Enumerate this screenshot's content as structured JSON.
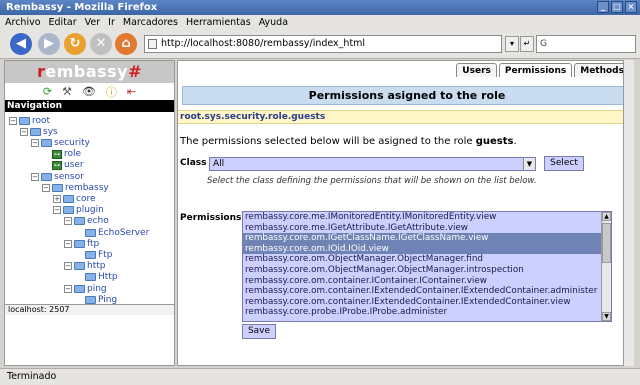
{
  "window": {
    "title": "Rembassy - Mozilla Firefox"
  },
  "menu": [
    "Archivo",
    "Editar",
    "Ver",
    "Ir",
    "Marcadores",
    "Herramientas",
    "Ayuda"
  ],
  "toolbar": {
    "url": "http://localhost:8080/rembassy/index_html",
    "search_placeholder": "G"
  },
  "brand": {
    "prefix": "r",
    "middle": "embassy",
    "suffix": "#"
  },
  "sidebar": {
    "nav_title": "Navigation",
    "status": "localhost: 2507",
    "tree": [
      {
        "label": "root",
        "type": "folder",
        "depth": 0,
        "expanded": true
      },
      {
        "label": "sys",
        "type": "folder",
        "depth": 1,
        "expanded": true
      },
      {
        "label": "security",
        "type": "folder",
        "depth": 2,
        "expanded": true
      },
      {
        "label": "role",
        "type": "leaf",
        "depth": 3
      },
      {
        "label": "user",
        "type": "leaf",
        "depth": 3
      },
      {
        "label": "sensor",
        "type": "folder",
        "depth": 2,
        "expanded": true
      },
      {
        "label": "rembassy",
        "type": "folder",
        "depth": 3,
        "expanded": true
      },
      {
        "label": "core",
        "type": "folder",
        "depth": 4,
        "expanded": false
      },
      {
        "label": "plugin",
        "type": "folder",
        "depth": 4,
        "expanded": true
      },
      {
        "label": "echo",
        "type": "folder",
        "depth": 5,
        "expanded": true
      },
      {
        "label": "EchoServer",
        "type": "folder",
        "depth": 6
      },
      {
        "label": "ftp",
        "type": "folder",
        "depth": 5,
        "expanded": true
      },
      {
        "label": "Ftp",
        "type": "folder",
        "depth": 6
      },
      {
        "label": "http",
        "type": "folder",
        "depth": 5,
        "expanded": true
      },
      {
        "label": "Http",
        "type": "folder",
        "depth": 6
      },
      {
        "label": "ping",
        "type": "folder",
        "depth": 5,
        "expanded": true
      },
      {
        "label": "Ping",
        "type": "folder",
        "depth": 6
      }
    ]
  },
  "tabs": [
    "Users",
    "Permissions",
    "Methods"
  ],
  "main": {
    "heading": "Permissions asigned to the role",
    "path": "root.sys.security.role.guests",
    "desc_prefix": "The permissions selected below will be asigned to the role ",
    "role_name": "guests",
    "class_label": "Class",
    "class_value": "All",
    "select_button": "Select",
    "class_hint": "Select the class defining the permissions that will be shown on the list below.",
    "permissions_label": "Permissions",
    "save_button": "Save",
    "permissions": [
      {
        "text": "rembassy.core.me.IMonitoredEntity.IMonitoredEntity.view",
        "selected": false
      },
      {
        "text": "rembassy.core.me.IGetAttribute.IGetAttribute.view",
        "selected": false
      },
      {
        "text": "rembassy.core.om.IGetClassName.IGetClassName.view",
        "selected": true
      },
      {
        "text": "rembassy.core.om.IOid.IOid.view",
        "selected": true
      },
      {
        "text": "rembassy.core.om.ObjectManager.ObjectManager.find",
        "selected": false
      },
      {
        "text": "rembassy.core.om.ObjectManager.ObjectManager.introspection",
        "selected": false
      },
      {
        "text": "rembassy.core.om.container.IContainer.IContainer.view",
        "selected": false
      },
      {
        "text": "rembassy.core.om.container.IExtendedContainer.IExtendedContainer.administer",
        "selected": false
      },
      {
        "text": "rembassy.core.om.container.IExtendedContainer.IExtendedContainer.view",
        "selected": false
      },
      {
        "text": "rembassy.core.probe.IProbe.IProbe.administer",
        "selected": false
      }
    ]
  },
  "statusbar": {
    "text": "Terminado"
  }
}
